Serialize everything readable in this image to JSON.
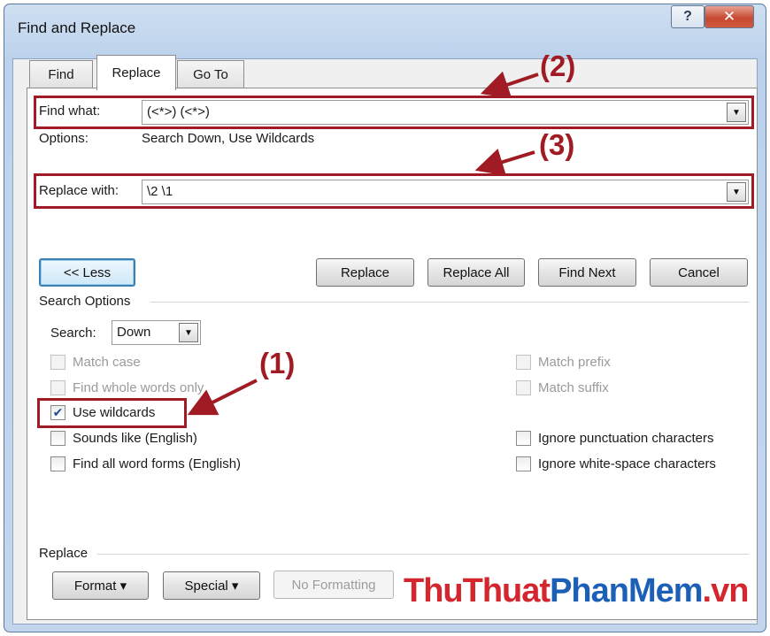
{
  "window": {
    "title": "Find and Replace",
    "help_glyph": "?",
    "close_glyph": "✕"
  },
  "tabs": [
    {
      "label": "Find",
      "accel": "d",
      "active": false
    },
    {
      "label": "Replace",
      "accel": "p",
      "active": true
    },
    {
      "label": "Go To",
      "accel": "G",
      "active": false
    }
  ],
  "find": {
    "label": "Find what:",
    "value": "(<*>) (<*>)",
    "options_label": "Options:",
    "options_value": "Search Down, Use Wildcards"
  },
  "replace": {
    "label": "Replace with:",
    "value": "\\2 \\1"
  },
  "buttons": {
    "less": "<< Less",
    "replace": "Replace",
    "replace_all": "Replace All",
    "find_next": "Find Next",
    "cancel": "Cancel"
  },
  "search_options": {
    "heading": "Search Options",
    "search_label": "Search:",
    "search_value": "Down",
    "left": [
      {
        "label": "Match case",
        "checked": false,
        "enabled": false
      },
      {
        "label": "Find whole words only",
        "checked": false,
        "enabled": false
      },
      {
        "label": "Use wildcards",
        "checked": true,
        "enabled": true
      },
      {
        "label": "Sounds like (English)",
        "checked": false,
        "enabled": true
      },
      {
        "label": "Find all word forms (English)",
        "checked": false,
        "enabled": true
      }
    ],
    "right": [
      {
        "label": "Match prefix",
        "checked": false,
        "enabled": false
      },
      {
        "label": "Match suffix",
        "checked": false,
        "enabled": false
      },
      {
        "label": "Ignore punctuation characters",
        "checked": false,
        "enabled": true
      },
      {
        "label": "Ignore white-space characters",
        "checked": false,
        "enabled": true
      }
    ]
  },
  "replace_section": {
    "heading": "Replace",
    "format_button": "Format ▾",
    "special_button": "Special ▾",
    "no_formatting_button": "No Formatting"
  },
  "annotations": {
    "one": "(1)",
    "two": "(2)",
    "three": "(3)"
  },
  "watermark": {
    "part1": "ThuThuat",
    "part2": "PhanMem",
    "part3": ".vn"
  },
  "colors": {
    "highlight": "#a11b24",
    "watermark_red": "#d3262e",
    "watermark_blue": "#1b5fb6"
  }
}
